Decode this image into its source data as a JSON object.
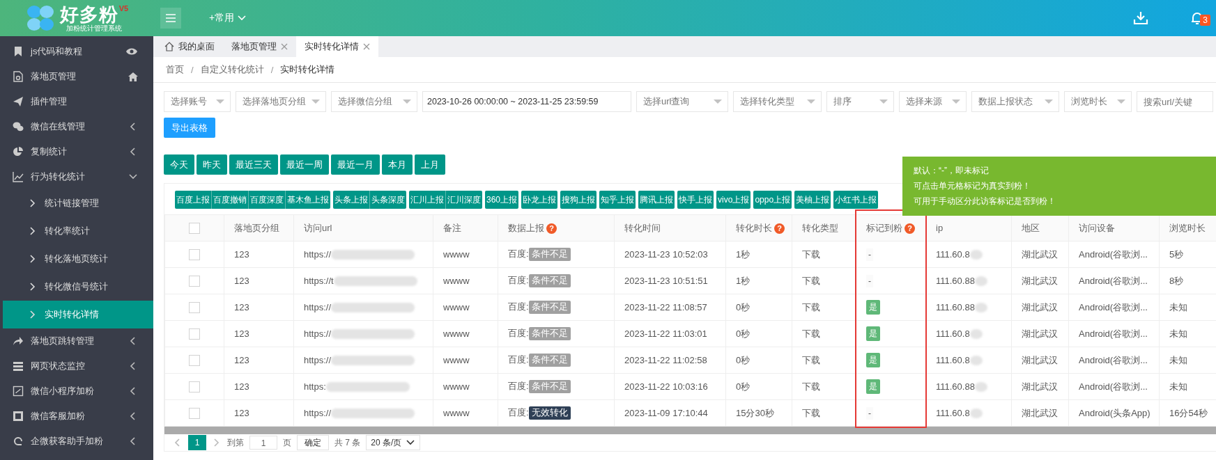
{
  "logo": {
    "name": "好多粉",
    "version": "V5",
    "subtitle": "加粉统计管理系统"
  },
  "header": {
    "menu_label": "+常用",
    "notification_count": "3"
  },
  "sidebar": {
    "items": [
      {
        "label": "js代码和教程",
        "selected": false
      },
      {
        "label": "落地页管理",
        "selected": false
      },
      {
        "label": "插件管理",
        "selected": false
      },
      {
        "label": "微信在线管理",
        "selected": false,
        "expanded": false
      },
      {
        "label": "复制统计",
        "selected": false,
        "expanded": false
      },
      {
        "label": "行为转化统计",
        "selected": false,
        "expanded": true,
        "children": [
          {
            "label": "统计链接管理",
            "selected": false
          },
          {
            "label": "转化率统计",
            "selected": false
          },
          {
            "label": "转化落地页统计",
            "selected": false
          },
          {
            "label": "转化微信号统计",
            "selected": false
          },
          {
            "label": "实时转化详情",
            "selected": true
          }
        ]
      },
      {
        "label": "落地页跳转管理",
        "selected": false,
        "expanded": false
      },
      {
        "label": "网页状态监控",
        "selected": false,
        "expanded": false
      },
      {
        "label": "微信小程序加粉",
        "selected": false,
        "expanded": false
      },
      {
        "label": "微信客服加粉",
        "selected": false,
        "expanded": false
      },
      {
        "label": "企微获客助手加粉",
        "selected": false,
        "expanded": false
      }
    ]
  },
  "tabs": [
    {
      "label": "我的桌面",
      "selected": false,
      "closable": false
    },
    {
      "label": "落地页管理",
      "selected": false,
      "closable": true
    },
    {
      "label": "实时转化详情",
      "selected": true,
      "closable": true
    }
  ],
  "breadcrumb": {
    "separator": "/",
    "items": [
      "首页",
      "自定义转化统计",
      "实时转化详情"
    ]
  },
  "filters": [
    {
      "kind": "select",
      "placeholder": "选择账号"
    },
    {
      "kind": "select",
      "placeholder": "选择落地页分组"
    },
    {
      "kind": "select",
      "placeholder": "选择微信分组"
    },
    {
      "kind": "date",
      "value": "2023-10-26 00:00:00 ~ 2023-11-25 23:59:59"
    },
    {
      "kind": "select",
      "placeholder": "选择url查询"
    },
    {
      "kind": "select",
      "placeholder": "选择转化类型"
    },
    {
      "kind": "select",
      "placeholder": "排序"
    },
    {
      "kind": "select",
      "placeholder": "选择来源"
    },
    {
      "kind": "select",
      "placeholder": "数据上报状态"
    },
    {
      "kind": "select",
      "placeholder": "浏览时长"
    },
    {
      "kind": "input",
      "placeholder": "搜索url/关键"
    }
  ],
  "export_button": "导出表格",
  "date_buttons": [
    "今天",
    "昨天",
    "最近三天",
    "最近一周",
    "最近一月",
    "本月",
    "上月"
  ],
  "report_buttons": [
    [
      "百度上报",
      "百度撤销",
      "百度深度",
      "基木鱼上报"
    ],
    [
      "头条上报",
      "头条深度"
    ],
    [
      "汇川上报",
      "汇川深度"
    ],
    [
      "360上报"
    ],
    [
      "卧龙上报"
    ],
    [
      "搜狗上报"
    ],
    [
      "知乎上报"
    ],
    [
      "腾讯上报"
    ],
    [
      "快手上报"
    ],
    [
      "vivo上报"
    ],
    [
      "oppo上报"
    ],
    [
      "美柚上报"
    ],
    [
      "小红书上报"
    ]
  ],
  "tooltip": [
    "默认：“-”，即未标记",
    "可点击单元格标记为真实到粉！",
    "可用于手动区分此访客标记是否到粉！"
  ],
  "table": {
    "select_all": {
      "checked": false
    },
    "columns": [
      {
        "label": "落地页分组",
        "highlighted": false
      },
      {
        "label": "访问url",
        "highlighted": false
      },
      {
        "label": "备注",
        "highlighted": false
      },
      {
        "label": "数据上报",
        "help": "?",
        "highlighted": false
      },
      {
        "label": "转化时间",
        "highlighted": false
      },
      {
        "label": "转化时长",
        "help": "?",
        "highlighted": false
      },
      {
        "label": "转化类型",
        "highlighted": false
      },
      {
        "label": "标记到粉",
        "help": "?",
        "highlighted": true
      },
      {
        "label": "ip",
        "highlighted": false
      },
      {
        "label": "地区",
        "highlighted": false
      },
      {
        "label": "访问设备",
        "highlighted": false
      },
      {
        "label": "浏览时长",
        "highlighted": false
      }
    ],
    "rows": [
      {
        "checked": false,
        "group": "123",
        "url": "https://",
        "remark": "wwww",
        "report_source": "百度:",
        "report_status": "条件不足",
        "report_invalid": false,
        "time": "2023-11-23 10:52:03",
        "duration": "1秒",
        "type": "下载",
        "fan_mark": "-",
        "fan_marked": false,
        "ip": "111.60.8",
        "region": "湖北武汉",
        "device": "Android(谷歌浏...",
        "browse": "5秒"
      },
      {
        "checked": false,
        "group": "123",
        "url": "https://t",
        "remark": "wwww",
        "report_source": "百度:",
        "report_status": "条件不足",
        "report_invalid": false,
        "time": "2023-11-23 10:51:51",
        "duration": "1秒",
        "type": "下载",
        "fan_mark": "-",
        "fan_marked": false,
        "ip": "111.60.88",
        "region": "湖北武汉",
        "device": "Android(谷歌浏...",
        "browse": "8秒"
      },
      {
        "checked": false,
        "group": "123",
        "url": "https://",
        "remark": "wwww",
        "report_source": "百度:",
        "report_status": "条件不足",
        "report_invalid": false,
        "time": "2023-11-22 11:08:57",
        "duration": "0秒",
        "type": "下载",
        "fan_mark": "是",
        "fan_marked": true,
        "ip": "111.60.88",
        "region": "湖北武汉",
        "device": "Android(谷歌浏...",
        "browse": "未知"
      },
      {
        "checked": false,
        "group": "123",
        "url": "https://",
        "remark": "wwww",
        "report_source": "百度:",
        "report_status": "条件不足",
        "report_invalid": false,
        "time": "2023-11-22 11:03:01",
        "duration": "0秒",
        "type": "下载",
        "fan_mark": "是",
        "fan_marked": true,
        "ip": "111.60.8",
        "region": "湖北武汉",
        "device": "Android(谷歌浏...",
        "browse": "未知"
      },
      {
        "checked": false,
        "group": "123",
        "url": "https://",
        "remark": "wwww",
        "report_source": "百度:",
        "report_status": "条件不足",
        "report_invalid": false,
        "time": "2023-11-22 11:02:58",
        "duration": "0秒",
        "type": "下载",
        "fan_mark": "是",
        "fan_marked": true,
        "ip": "111.60.8",
        "region": "湖北武汉",
        "device": "Android(谷歌浏...",
        "browse": "未知"
      },
      {
        "checked": false,
        "group": "123",
        "url": "https:",
        "remark": "wwww",
        "report_source": "百度:",
        "report_status": "条件不足",
        "report_invalid": false,
        "time": "2023-11-22 10:03:16",
        "duration": "0秒",
        "type": "下载",
        "fan_mark": "是",
        "fan_marked": true,
        "ip": "111.60.88",
        "region": "湖北武汉",
        "device": "Android(谷歌浏...",
        "browse": "未知"
      },
      {
        "checked": false,
        "group": "123",
        "url": "https://",
        "remark": "wwww",
        "report_source": "百度:",
        "report_status": "无效转化",
        "report_invalid": true,
        "time": "2023-11-09 17:10:44",
        "duration": "15分30秒",
        "type": "下载",
        "fan_mark": "-",
        "fan_marked": false,
        "ip": "111.60.8",
        "region": "湖北武汉",
        "device": "Android(头条App)",
        "browse": "16分54秒"
      }
    ]
  },
  "pagination": {
    "pages": [
      {
        "label": "1",
        "selected": true
      }
    ],
    "goto_label": "到第",
    "goto_value": "1",
    "page_unit": "页",
    "confirm": "确定",
    "total": "共 7 条",
    "page_size": "20 条/页"
  }
}
